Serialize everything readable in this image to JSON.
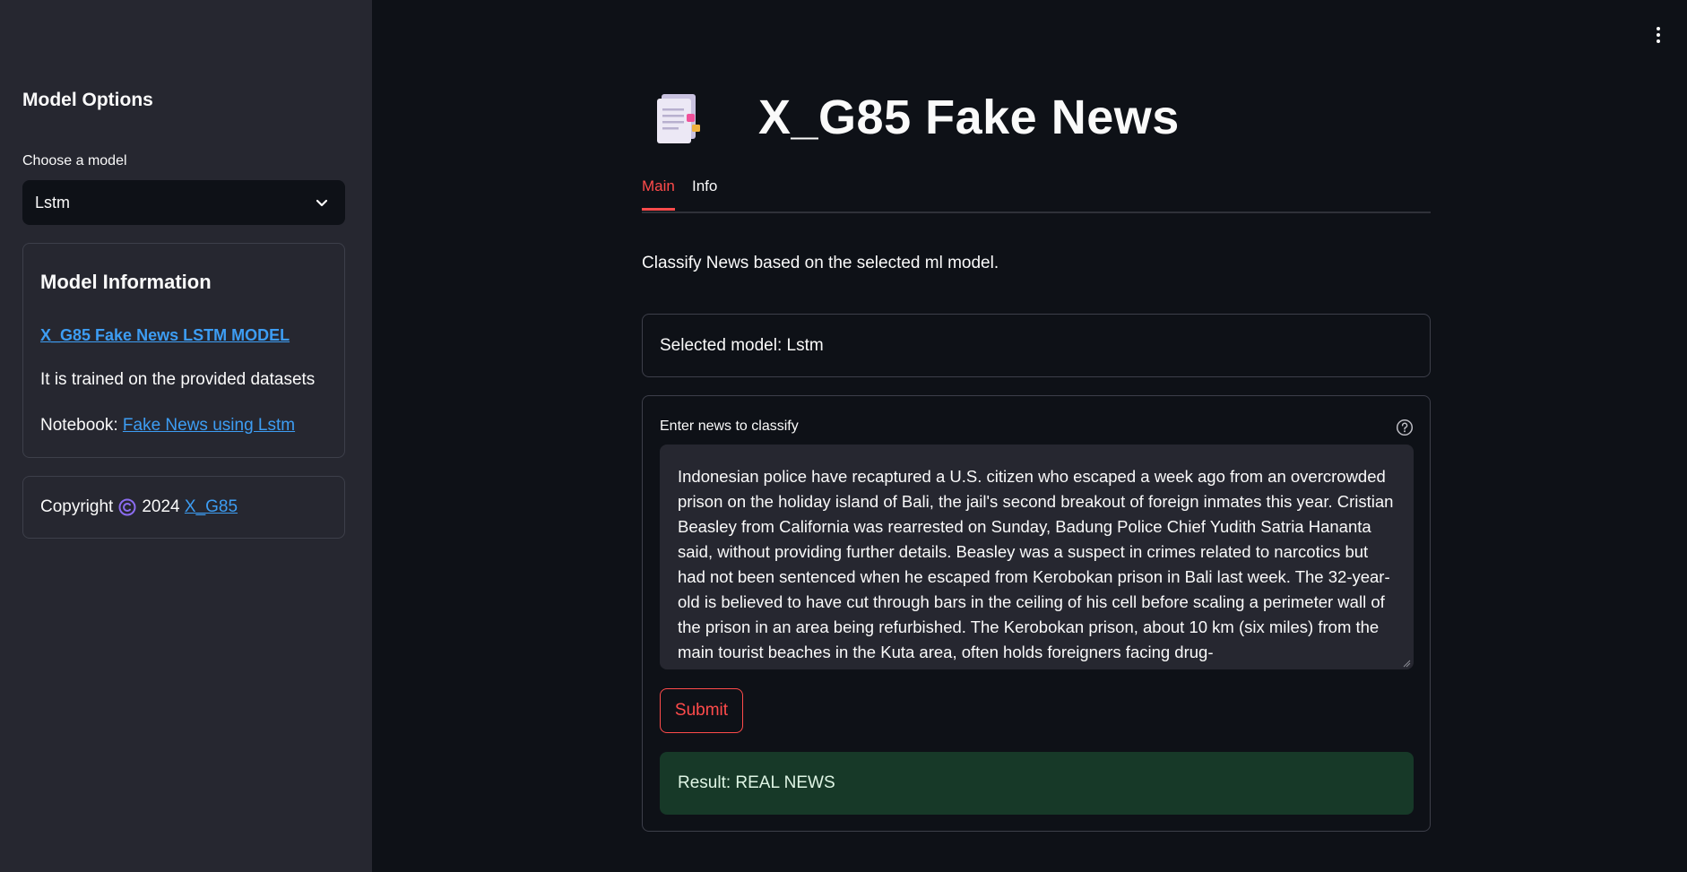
{
  "sidebar": {
    "title": "Model Options",
    "select_label": "Choose a model",
    "select_value": "Lstm",
    "info": {
      "heading": "Model Information",
      "model_link": "X_G85 Fake News LSTM MODEL",
      "trained_text": "It is trained on the provided datasets",
      "notebook_prefix": "Notebook:",
      "notebook_link": "Fake News using Lstm"
    },
    "copyright": {
      "prefix": "Copyright",
      "year": "2024",
      "author_link": "X_G85"
    }
  },
  "header": {
    "title": "X_G85 Fake News",
    "icon": "document-notepad-icon"
  },
  "tabs": [
    {
      "label": "Main",
      "active": true
    },
    {
      "label": "Info",
      "active": false
    }
  ],
  "main": {
    "description": "Classify News based on the selected ml model.",
    "selected_model_text": "Selected model: Lstm",
    "form": {
      "label": "Enter news to classify",
      "textarea_value": "Indonesian police have recaptured a U.S. citizen who escaped a week ago from an overcrowded prison on the holiday island of Bali, the jail's second breakout of foreign inmates this year. Cristian Beasley from California was rearrested on Sunday, Badung Police Chief Yudith Satria Hananta said, without providing further details.  Beasley was a suspect in crimes related to narcotics but had not been sentenced when he escaped from Kerobokan prison in Bali last week. The 32-year-old is believed to have cut through bars in the ceiling of his cell before scaling a perimeter wall of the prison in an area being refurbished. The Kerobokan prison, about 10 km (six miles) from the main tourist beaches in the Kuta area, often holds foreigners facing drug-",
      "submit_label": "Submit",
      "result_text": "Result: REAL NEWS"
    }
  },
  "colors": {
    "accent": "#ff4b4b",
    "link": "#3d9df3",
    "success_bg": "#173928",
    "sidebar_bg": "#262730",
    "main_bg": "#0e1117"
  }
}
